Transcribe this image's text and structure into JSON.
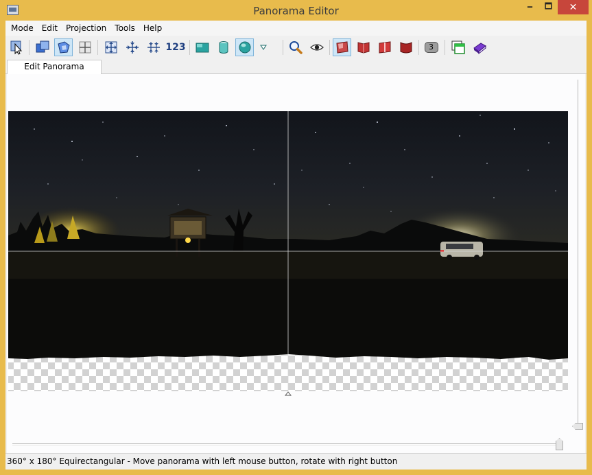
{
  "window": {
    "title": "Panorama Editor",
    "minimize_label": "🗕",
    "maximize_label": "🗖",
    "close_label": "✕"
  },
  "menu": {
    "items": [
      "Mode",
      "Edit",
      "Projection",
      "Tools",
      "Help"
    ]
  },
  "toolbar": {
    "numbers_label": "123",
    "buttons": [
      {
        "icon": "select-arrow-icon",
        "active": false
      },
      {
        "icon": "move-image-icon",
        "active": false
      },
      {
        "icon": "rotate-image-icon",
        "active": true
      },
      {
        "icon": "crosshair-icon",
        "active": false
      },
      {
        "icon": "fit-all-icon",
        "active": false
      },
      {
        "icon": "center-icon",
        "active": false
      },
      {
        "icon": "fit-horizontal-icon",
        "active": false
      },
      {
        "icon": "numbers-icon",
        "active": false
      },
      {
        "icon": "rectilinear-projection-icon",
        "active": false
      },
      {
        "icon": "cylindrical-projection-icon",
        "active": false
      },
      {
        "icon": "spherical-projection-icon",
        "active": true
      },
      {
        "icon": "projection-dropdown-icon",
        "active": false
      },
      {
        "icon": "zoom-icon",
        "active": false
      },
      {
        "icon": "preview-eye-icon",
        "active": false
      },
      {
        "icon": "layer-red-1-icon",
        "active": true
      },
      {
        "icon": "layer-red-2-icon",
        "active": false
      },
      {
        "icon": "layer-red-3-icon",
        "active": false
      },
      {
        "icon": "layer-red-4-icon",
        "active": false
      },
      {
        "icon": "count-badge-icon",
        "active": false
      },
      {
        "icon": "window-green-icon",
        "active": false
      },
      {
        "icon": "book-icon",
        "active": false
      }
    ],
    "badge_count": "3"
  },
  "tabs": [
    {
      "label": "Edit Panorama",
      "selected": true
    }
  ],
  "status": {
    "text": "360° x 180° Equirectangular - Move panorama with left mouse button, rotate with right button"
  },
  "colors": {
    "frame": "#e8bb4c",
    "close_button": "#c7463b",
    "active_tool": "#cde6f7",
    "panorama_sky": "#14171c",
    "panorama_ground": "#0b0b09",
    "street_light": "#ffd84a"
  }
}
